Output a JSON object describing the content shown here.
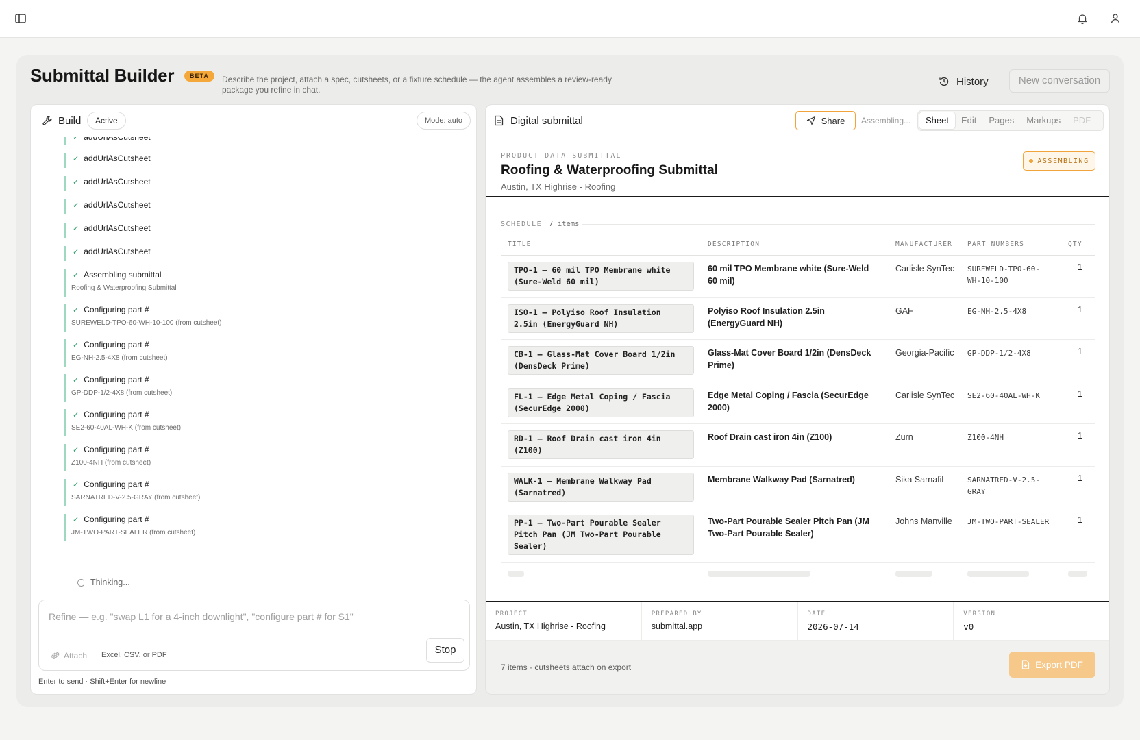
{
  "header": {
    "sidebar_toggle": "sidebar-toggle-icon",
    "notifications": "bell-icon",
    "account": "user-icon"
  },
  "page": {
    "title": "Submittal Builder",
    "badge": "BETA",
    "subtitle": "Describe the project, attach a spec, cutsheets, or a fixture schedule — the agent assembles a review-ready package you refine in chat.",
    "history_label": "History",
    "new_conversation_label": "New conversation"
  },
  "build": {
    "title": "Build",
    "status": "Active",
    "mode": "Mode: auto",
    "log": [
      {
        "main": "addUrlAsCutsheet",
        "sub": ""
      },
      {
        "main": "addUrlAsCutsheet",
        "sub": ""
      },
      {
        "main": "addUrlAsCutsheet",
        "sub": ""
      },
      {
        "main": "addUrlAsCutsheet",
        "sub": ""
      },
      {
        "main": "addUrlAsCutsheet",
        "sub": ""
      },
      {
        "main": "addUrlAsCutsheet",
        "sub": ""
      },
      {
        "main": "Assembling submittal",
        "sub": "Roofing & Waterproofing Submittal"
      },
      {
        "main": "Configuring part #",
        "sub": "SUREWELD-TPO-60-WH-10-100 (from cutsheet)"
      },
      {
        "main": "Configuring part #",
        "sub": "EG-NH-2.5-4X8 (from cutsheet)"
      },
      {
        "main": "Configuring part #",
        "sub": "GP-DDP-1/2-4X8 (from cutsheet)"
      },
      {
        "main": "Configuring part #",
        "sub": "SE2-60-40AL-WH-K (from cutsheet)"
      },
      {
        "main": "Configuring part #",
        "sub": "Z100-4NH (from cutsheet)"
      },
      {
        "main": "Configuring part #",
        "sub": "SARNATRED-V-2.5-GRAY (from cutsheet)"
      },
      {
        "main": "Configuring part #",
        "sub": "JM-TWO-PART-SEALER (from cutsheet)"
      }
    ],
    "thinking": "Thinking...",
    "input_placeholder": "Refine — e.g. \"swap L1 for a 4-inch downlight\", \"configure part # for S1\"",
    "attach_label": "Attach",
    "file_types": "Excel, CSV, or PDF",
    "stop_label": "Stop",
    "hint": "Enter to send · Shift+Enter for newline"
  },
  "document": {
    "title": "Digital submittal",
    "share_label": "Share",
    "assembling_text": "Assembling...",
    "tabs": [
      "Sheet",
      "Edit",
      "Pages",
      "Markups",
      "PDF"
    ],
    "active_tab": "Sheet",
    "eyebrow": "PRODUCT DATA SUBMITTAL",
    "heading": "Roofing & Waterproofing Submittal",
    "project_line": "Austin, TX Highrise - Roofing",
    "status_badge": "ASSEMBLING",
    "schedule_label": "SCHEDULE",
    "schedule_count": "7 items",
    "columns": [
      "TITLE",
      "DESCRIPTION",
      "MANUFACTURER",
      "PART NUMBERS",
      "QTY"
    ],
    "rows": [
      {
        "title": "TPO-1 — 60 mil TPO Membrane white (Sure-Weld 60 mil)",
        "description": "60 mil TPO Membrane white (Sure-Weld 60 mil)",
        "manufacturer": "Carlisle SynTec",
        "part": "SUREWELD-TPO-60-WH-10-100",
        "qty": "1"
      },
      {
        "title": "ISO-1 — Polyiso Roof Insulation 2.5in (EnergyGuard NH)",
        "description": "Polyiso Roof Insulation 2.5in (EnergyGuard NH)",
        "manufacturer": "GAF",
        "part": "EG-NH-2.5-4X8",
        "qty": "1"
      },
      {
        "title": "CB-1 — Glass-Mat Cover Board 1/2in (DensDeck Prime)",
        "description": "Glass-Mat Cover Board 1/2in (DensDeck Prime)",
        "manufacturer": "Georgia-Pacific",
        "part": "GP-DDP-1/2-4X8",
        "qty": "1"
      },
      {
        "title": "FL-1 — Edge Metal Coping / Fascia (SecurEdge 2000)",
        "description": "Edge Metal Coping / Fascia (SecurEdge 2000)",
        "manufacturer": "Carlisle SynTec",
        "part": "SE2-60-40AL-WH-K",
        "qty": "1"
      },
      {
        "title": "RD-1 — Roof Drain cast iron 4in (Z100)",
        "description": "Roof Drain cast iron 4in (Z100)",
        "manufacturer": "Zurn",
        "part": "Z100-4NH",
        "qty": "1"
      },
      {
        "title": "WALK-1 — Membrane Walkway Pad (Sarnatred)",
        "description": "Membrane Walkway Pad (Sarnatred)",
        "manufacturer": "Sika Sarnafil",
        "part": "SARNATRED-V-2.5-GRAY",
        "qty": "1"
      },
      {
        "title": "PP-1 — Two-Part Pourable Sealer Pitch Pan (JM Two-Part Pourable Sealer)",
        "description": "Two-Part Pourable Sealer Pitch Pan (JM Two-Part Pourable Sealer)",
        "manufacturer": "Johns Manville",
        "part": "JM-TWO-PART-SEALER",
        "qty": "1"
      }
    ],
    "meta": [
      {
        "key": "PROJECT",
        "value": "Austin, TX Highrise - Roofing"
      },
      {
        "key": "PREPARED BY",
        "value": "submittal.app"
      },
      {
        "key": "DATE",
        "value": "2026-07-14"
      },
      {
        "key": "VERSION",
        "value": "v0"
      }
    ],
    "footer_note": "7 items · cutsheets attach on export",
    "export_label": "Export PDF"
  },
  "colors": {
    "accent": "#f0a43a",
    "log_bar": "#9ed8c0",
    "check": "#2f9e6f",
    "export_disabled": "#f6c88a"
  }
}
